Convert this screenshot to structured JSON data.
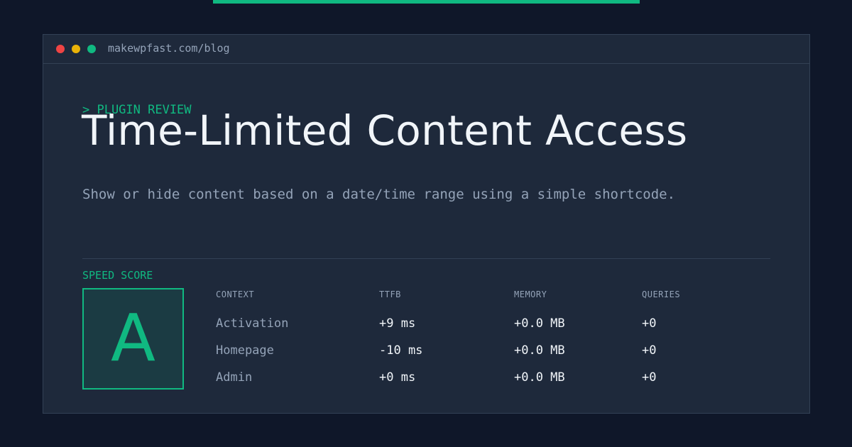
{
  "window": {
    "url": "makewpfast.com/blog"
  },
  "article": {
    "kicker": "> PLUGIN REVIEW",
    "title": "Time-Limited Content Access",
    "subtitle": "Show or hide content based on a date/time range using a simple shortcode."
  },
  "score": {
    "label": "SPEED SCORE",
    "grade": "A"
  },
  "table": {
    "headers": [
      "CONTEXT",
      "TTFB",
      "MEMORY",
      "QUERIES"
    ],
    "rows": [
      {
        "context": "Activation",
        "ttfb": "+9 ms",
        "memory": "+0.0 MB",
        "queries": "+0"
      },
      {
        "context": "Homepage",
        "ttfb": "-10 ms",
        "memory": "+0.0 MB",
        "queries": "+0"
      },
      {
        "context": "Admin",
        "ttfb": "+0 ms",
        "memory": "+0.0 MB",
        "queries": "+0"
      }
    ]
  },
  "colors": {
    "background": "#0f1729",
    "panel": "#1e293b",
    "accent": "#10b981",
    "text": "#f1f5f9",
    "muted": "#94a3b8",
    "dot_red": "#ef4444",
    "dot_yellow": "#eab308",
    "dot_green": "#10b981"
  }
}
